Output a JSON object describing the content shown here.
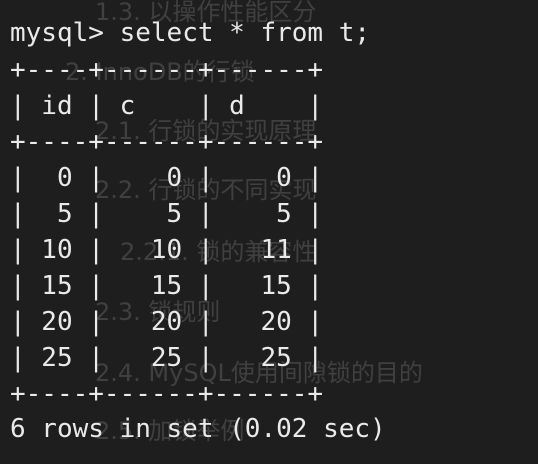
{
  "background_toc": [
    "1.3. 以操作性能区分",
    "2. InnoDB的行锁",
    "2.1. 行锁的实现原理",
    "2.2. 行锁的不同实现",
    "2.2.1. 锁的兼容性",
    "2.3. 锁规则",
    "2.4. MySQL使用间隙锁的目的",
    "2.5. 加锁举例"
  ],
  "terminal": {
    "prompt": "mysql> ",
    "command": "select * from t;",
    "border": "+----+------+------+",
    "header": "| id | c    | d    |",
    "rows": [
      "|  0 |    0 |    0 |",
      "|  5 |    5 |    5 |",
      "| 10 |   10 |   11 |",
      "| 15 |   15 |   15 |",
      "| 20 |   20 |   20 |",
      "| 25 |   25 |   25 |"
    ],
    "footer": "6 rows in set (0.02 sec)"
  }
}
